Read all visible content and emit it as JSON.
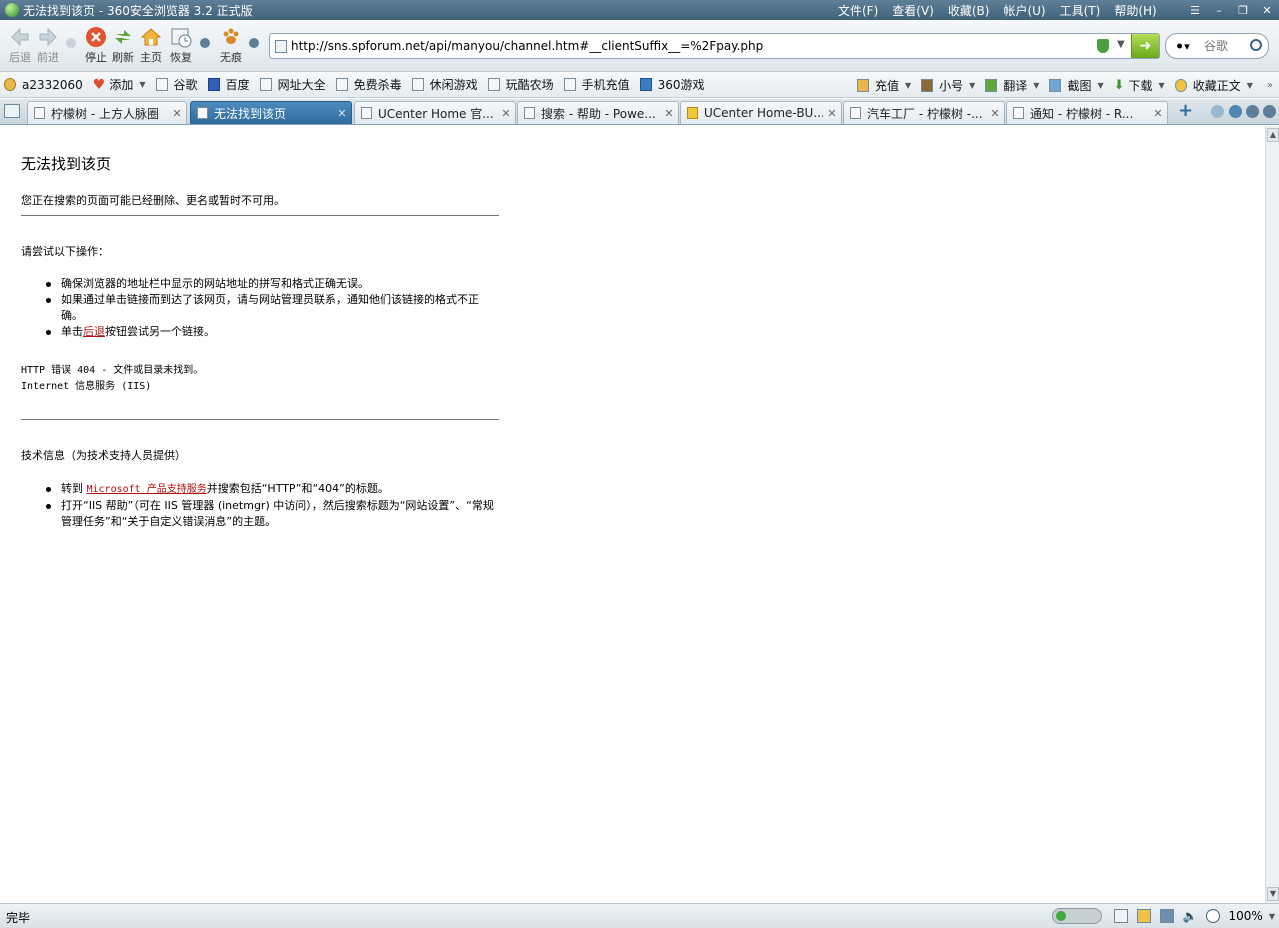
{
  "window": {
    "title": "无法找到该页 - 360安全浏览器 3.2 正式版",
    "menus": [
      "文件(F)",
      "查看(V)",
      "收藏(B)",
      "帐户(U)",
      "工具(T)",
      "帮助(H)"
    ]
  },
  "nav": {
    "back": "后退",
    "forward": "前进",
    "stop": "停止",
    "refresh": "刷新",
    "home": "主页",
    "restore": "恢复",
    "incognito": "无痕",
    "url": "http://sns.spforum.net/api/manyou/channel.htm#__clientSuffix__=%2Fpay.php",
    "search_engine": "谷歌"
  },
  "favorites": {
    "user": "a2332060",
    "add": "添加",
    "items": [
      "谷歌",
      "百度",
      "网址大全",
      "免费杀毒",
      "休闲游戏",
      "玩酷农场",
      "手机充值",
      "360游戏"
    ],
    "right_items": [
      "充值",
      "小号",
      "翻译",
      "截图",
      "下载",
      "收藏正文"
    ]
  },
  "tabs": [
    {
      "title": "柠檬树 - 上方人脉圈",
      "active": false
    },
    {
      "title": "无法找到该页",
      "active": true
    },
    {
      "title": "UCenter Home 官...",
      "active": false
    },
    {
      "title": "搜索 - 帮助 - Powe...",
      "active": false
    },
    {
      "title": "UCenter Home-BU...",
      "active": false
    },
    {
      "title": "汽车工厂 - 柠檬树 -...",
      "active": false
    },
    {
      "title": "通知 - 柠檬树 - R...",
      "active": false
    }
  ],
  "page": {
    "heading": "无法找到该页",
    "intro": "您正在搜索的页面可能已经删除、更名或暂时不可用。",
    "try_heading": "请尝试以下操作：",
    "try_items": [
      "确保浏览器的地址栏中显示的网站地址的拼写和格式正确无误。",
      "如果通过单击链接而到达了该网页，请与网站管理员联系，通知他们该链接的格式不正确。"
    ],
    "back_prefix": "单击",
    "back_link": "后退",
    "back_suffix": "按钮尝试另一个链接。",
    "error_line": "HTTP 错误 404 - 文件或目录未找到。",
    "server_line": "Internet 信息服务 (IIS)",
    "tech_heading": "技术信息（为技术支持人员提供）",
    "tech_prefix": "转到 ",
    "tech_link": "Microsoft 产品支持服务",
    "tech_suffix": "并搜索包括“HTTP”和“404”的标题。",
    "tech_item2": "打开“IIS 帮助”（可在 IIS 管理器 (inetmgr) 中访问），然后搜索标题为“网站设置”、“常规管理任务”和“关于自定义错误消息”的主题。"
  },
  "status": {
    "text": "完毕",
    "zoom": "100%"
  },
  "colors": {
    "titlebar": "#3f6179",
    "active_tab": "#2f6c9f",
    "link": "#b01010",
    "go_button": "#6aa81a"
  }
}
